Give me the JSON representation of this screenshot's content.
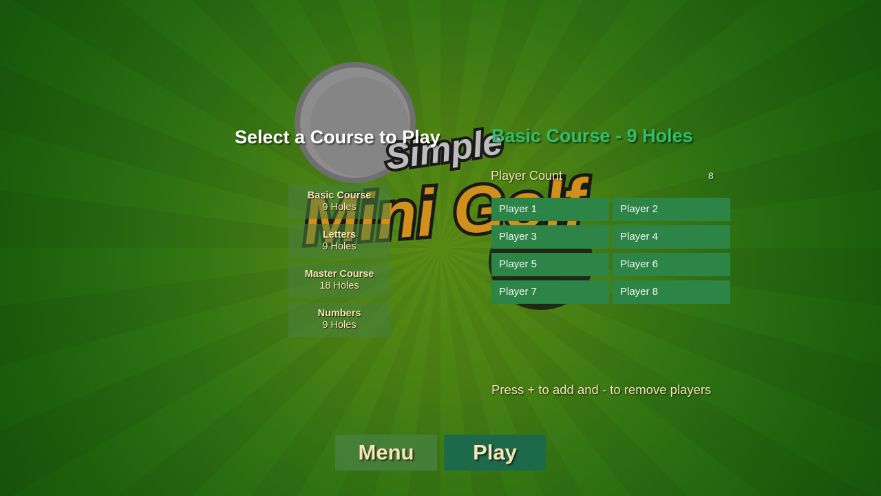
{
  "colors": {
    "background": "#3c7a12",
    "course_title": "#2fbf6b",
    "player_slot": "#2c8446",
    "play_button": "#1c6a4a",
    "label_text": "#f6e3b8"
  },
  "logo": {
    "line1": "Simple",
    "line2": "Mini Golf"
  },
  "course_select": {
    "heading": "Select a Course to Play",
    "courses": [
      {
        "name": "Basic Course",
        "holes": "9 Holes"
      },
      {
        "name": "Letters",
        "holes": "9 Holes"
      },
      {
        "name": "Master Course",
        "holes": "18 Holes"
      },
      {
        "name": "Numbers",
        "holes": "9 Holes"
      }
    ]
  },
  "details": {
    "course_title": "Basic Course - 9 Holes",
    "player_count_label": "Player Count",
    "player_count_value": "8",
    "players": [
      "Player 1",
      "Player 2",
      "Player 3",
      "Player 4",
      "Player 5",
      "Player 6",
      "Player 7",
      "Player 8"
    ],
    "hint": "Press + to add and - to remove players"
  },
  "buttons": {
    "menu": "Menu",
    "play": "Play"
  }
}
